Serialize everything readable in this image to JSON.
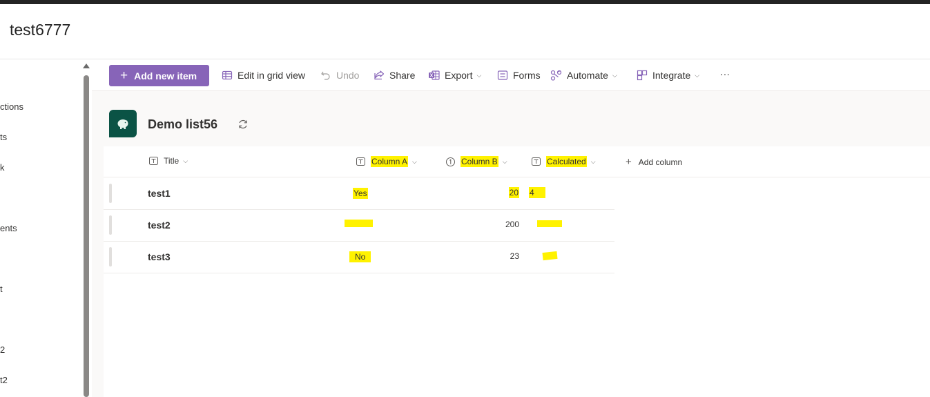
{
  "site": {
    "title": "test6777"
  },
  "leftnav": {
    "items": [
      "ctions",
      "ts",
      "k",
      "ents",
      "t",
      "2",
      "t2"
    ]
  },
  "toolbar": {
    "add_new_item": "Add new item",
    "edit_grid": "Edit in grid view",
    "undo": "Undo",
    "share": "Share",
    "export": "Export",
    "forms": "Forms",
    "automate": "Automate",
    "integrate": "Integrate",
    "more": "···"
  },
  "list": {
    "title": "Demo list56"
  },
  "grid": {
    "columns": [
      "Title",
      "Column A",
      "Column B",
      "Calculated"
    ],
    "add_column": "Add column",
    "rows": [
      {
        "title": "test1",
        "column_a": "Yes",
        "column_b": "20",
        "calculated": "4"
      },
      {
        "title": "test2",
        "column_a": "",
        "column_b": "200",
        "calculated": ""
      },
      {
        "title": "test3",
        "column_a": "No",
        "column_b": "23",
        "calculated": ""
      }
    ]
  },
  "colors": {
    "accent": "#8764b8",
    "list_icon": "#0b5345",
    "highlight": "#fff200"
  },
  "icons": [
    "plus-icon",
    "grid-view-icon",
    "undo-icon",
    "share-icon",
    "excel-icon",
    "forms-icon",
    "automate-icon",
    "integrate-icon",
    "more-icon",
    "refresh-icon",
    "text-column-icon",
    "number-column-icon",
    "add-column-icon",
    "chevron-down-icon"
  ]
}
